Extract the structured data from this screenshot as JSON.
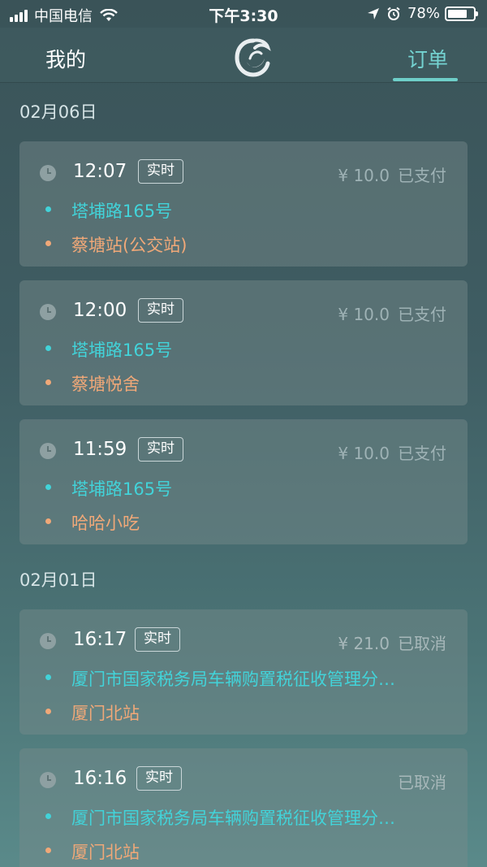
{
  "status_bar": {
    "carrier": "中国电信",
    "time": "下午3:30",
    "battery_percent": "78%",
    "battery_level": 0.78
  },
  "nav": {
    "left_label": "我的",
    "right_label": "订单"
  },
  "groups": [
    {
      "date": "02月06日",
      "orders": [
        {
          "time": "12:07",
          "tag": "实时",
          "price": "¥ 10.0",
          "status": "已支付",
          "from": "塔埔路165号",
          "to": "蔡塘站(公交站)"
        },
        {
          "time": "12:00",
          "tag": "实时",
          "price": "¥ 10.0",
          "status": "已支付",
          "from": "塔埔路165号",
          "to": "蔡塘悦舍"
        },
        {
          "time": "11:59",
          "tag": "实时",
          "price": "¥ 10.0",
          "status": "已支付",
          "from": "塔埔路165号",
          "to": "哈哈小吃"
        }
      ]
    },
    {
      "date": "02月01日",
      "orders": [
        {
          "time": "16:17",
          "tag": "实时",
          "price": "¥ 21.0",
          "status": "已取消",
          "from": "厦门市国家税务局车辆购置税征收管理分…",
          "to": "厦门北站"
        },
        {
          "time": "16:16",
          "tag": "实时",
          "price": "",
          "status": "已取消",
          "from": "厦门市国家税务局车辆购置税征收管理分…",
          "to": "厦门北站"
        }
      ]
    }
  ],
  "icons": {
    "clock": "clock-icon",
    "logo": "dragon-logo-icon",
    "wifi": "wifi-icon",
    "location": "location-arrow-icon",
    "alarm": "alarm-icon"
  },
  "colors": {
    "from_address": "#42d3d9",
    "to_address": "#f0a878",
    "active_tab": "#74d3d1"
  }
}
